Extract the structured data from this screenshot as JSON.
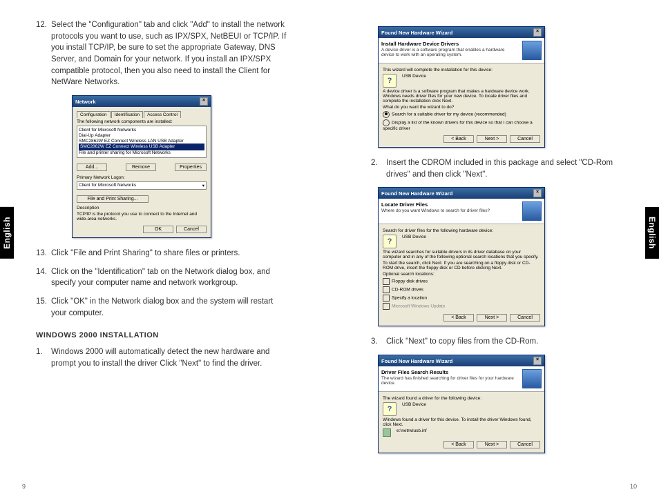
{
  "side_tab": "English",
  "page_left": "9",
  "page_right": "10",
  "left": {
    "step12": {
      "num": "12.",
      "text": "Select the \"Configuration\" tab and click \"Add\" to install the network protocols you want to use, such as IPX/SPX, NetBEUI or TCP/IP. If you install TCP/IP, be sure to set the appropriate Gateway, DNS Server, and Domain for your network. If you install an IPX/SPX compatible protocol, then you also need to install the Client for NetWare Networks."
    },
    "dlg1": {
      "title": "Network",
      "tabs": [
        "Configuration",
        "Identification",
        "Access Control"
      ],
      "list_label": "The following network components are installed:",
      "items": [
        "Client for Microsoft Networks",
        "Dial-Up Adapter",
        "SMC2862W EZ Connect Wireless LAN USB Adapter",
        "SMC2862W EZ Connect Wireless USB Adapter",
        "File and printer sharing for Microsoft Networks"
      ],
      "selected_index": 3,
      "btn_add": "Add...",
      "btn_remove": "Remove",
      "btn_props": "Properties",
      "logon_label": "Primary Network Logon:",
      "logon_value": "Client for Microsoft Networks",
      "file_print_btn": "File and Print Sharing...",
      "desc_label": "Description",
      "desc_text": "TCP/IP is the protocol you use to connect to the Internet and wide-area networks.",
      "btn_ok": "OK",
      "btn_cancel": "Cancel"
    },
    "step13": {
      "num": "13.",
      "text": "Click \"File and Print Sharing\" to share files or printers."
    },
    "step14": {
      "num": "14.",
      "text": "Click on the \"Identification\" tab on the Network dialog box, and specify your computer name and network workgroup."
    },
    "step15": {
      "num": "15.",
      "text": "Click \"OK\" in the Network dialog box and the system will restart your computer."
    },
    "section_heading": "WINDOWS 2000 INSTALLATION",
    "w1": {
      "num": "1.",
      "text": "Windows 2000 will automatically detect the new hardware and prompt you to install the driver Click \"Next\" to find the driver."
    }
  },
  "right": {
    "dlg2": {
      "title": "Found New Hardware Wizard",
      "head_title": "Install Hardware Device Drivers",
      "head_sub": "A device driver is a software program that enables a hardware device to work with an operating system.",
      "line1": "This wizard will complete the installation for this device:",
      "device": "USB Device",
      "line2": "A device driver is a software program that makes a hardware device work. Windows needs driver files for your new device. To locate driver files and complete the installation click Next.",
      "q": "What do you want the wizard to do?",
      "opt1": "Search for a suitable driver for my device (recommended)",
      "opt2": "Display a list of the known drivers for this device so that I can choose a specific driver",
      "btn_back": "< Back",
      "btn_next": "Next >",
      "btn_cancel": "Cancel"
    },
    "step2": {
      "num": "2.",
      "text": "Insert the CDROM included in this package and select \"CD-Rom drives\" and then click \"Next\"."
    },
    "dlg3": {
      "title": "Found New Hardware Wizard",
      "head_title": "Locate Driver Files",
      "head_sub": "Where do you want Windows to search for driver files?",
      "line1": "Search for driver files for the following hardware device:",
      "device": "USB Device",
      "line2": "The wizard searches for suitable drivers in its driver database on your computer and in any of the following optional search locations that you specify.",
      "line3": "To start the search, click Next. If you are searching on a floppy disk or CD-ROM drive, insert the floppy disk or CD before clicking Next.",
      "loc_label": "Optional search locations:",
      "opt_a": "Floppy disk drives",
      "opt_b": "CD-ROM drives",
      "opt_c": "Specify a location",
      "opt_d": "Microsoft Windows Update",
      "btn_back": "< Back",
      "btn_next": "Next >",
      "btn_cancel": "Cancel"
    },
    "step3": {
      "num": "3.",
      "text": "Click \"Next\" to copy files from the CD-Rom."
    },
    "dlg4": {
      "title": "Found New Hardware Wizard",
      "head_title": "Driver Files Search Results",
      "head_sub": "The wizard has finished searching for driver files for your hardware device.",
      "line1": "The wizard found a driver for the following device:",
      "device": "USB Device",
      "line2": "Windows found a driver for this device. To install the driver Windows found, click Next.",
      "path": "e:\\netrwlusb.inf",
      "btn_back": "< Back",
      "btn_next": "Next >",
      "btn_cancel": "Cancel"
    }
  }
}
